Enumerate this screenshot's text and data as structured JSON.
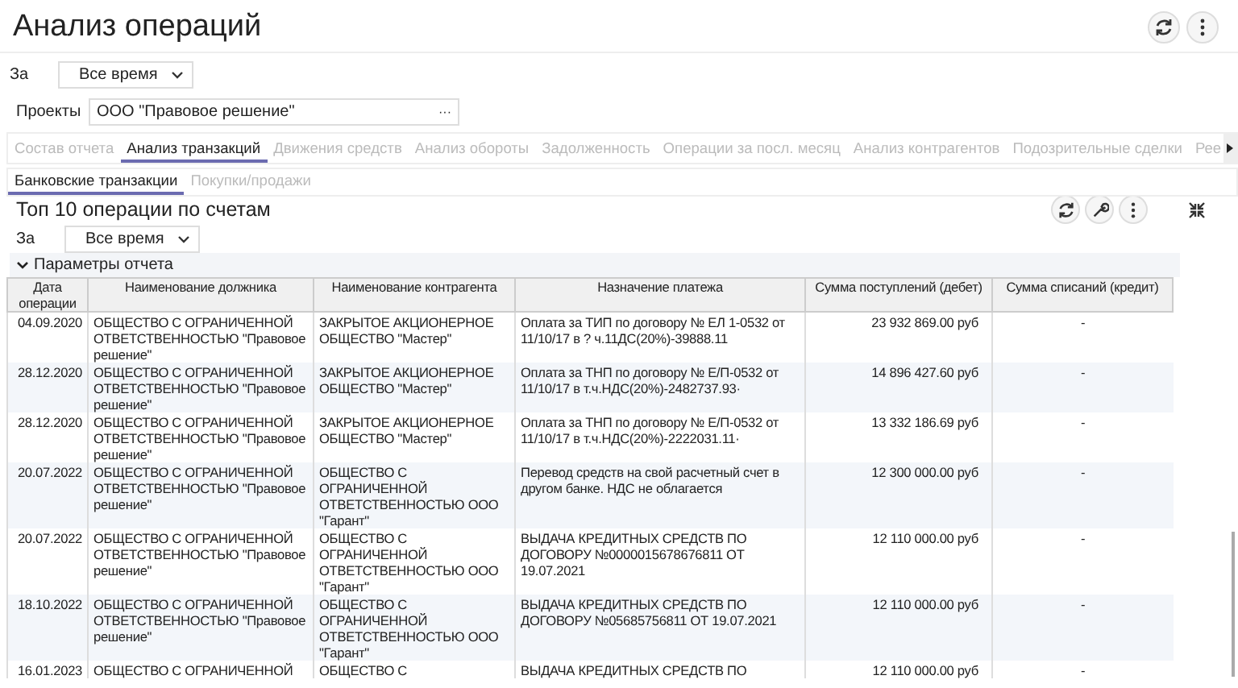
{
  "window": {
    "title": "Анализ операций"
  },
  "period": {
    "label": "За",
    "value": "Все время"
  },
  "projects": {
    "label": "Проекты",
    "value": "ООО \"Правовое решение\"",
    "button": "···"
  },
  "tabs": [
    {
      "label": "Состав отчета",
      "selected": false
    },
    {
      "label": "Анализ транзакций",
      "selected": true
    },
    {
      "label": "Движения средств",
      "selected": false
    },
    {
      "label": "Анализ обороты",
      "selected": false
    },
    {
      "label": "Задолженность",
      "selected": false
    },
    {
      "label": "Операции за посл. месяц",
      "selected": false
    },
    {
      "label": "Анализ контрагентов",
      "selected": false
    },
    {
      "label": "Подозрительные сделки",
      "selected": false
    },
    {
      "label": "Рее",
      "selected": false
    }
  ],
  "subtabs": [
    {
      "label": "Банковские транзакции",
      "selected": true
    },
    {
      "label": "Покупки/продажи",
      "selected": false
    }
  ],
  "report": {
    "title": "Топ 10 операции по счетам",
    "period": {
      "label": "За",
      "value": "Все время"
    },
    "params": {
      "label": "Параметры отчета",
      "expanded": true
    }
  },
  "table": {
    "columns": [
      "Дата операции",
      "Наименование должника",
      "Наименование контрагента",
      "Назначение платежа",
      "Сумма поступлений (дебет)",
      "Сумма списаний (кредит)"
    ],
    "rows": [
      [
        "04.09.2020",
        "ОБЩЕСТВО С ОГРАНИЧЕННОЙ ОТВЕТСТВЕННОСТЬЮ \"Правовое решение\"",
        "ЗАКРЫТОЕ АКЦИОНЕРНОЕ ОБЩЕСТВО \"Мастер\"",
        "Оплата за ТИП по договору № ЕЛ 1-0532 от 11/10/17 в ? ч.11ДС(20%)-39888.11",
        "23 932 869.00  руб",
        "-"
      ],
      [
        "28.12.2020",
        "ОБЩЕСТВО С ОГРАНИЧЕННОЙ ОТВЕТСТВЕННОСТЬЮ \"Правовое решение\"",
        "ЗАКРЫТОЕ АКЦИОНЕРНОЕ ОБЩЕСТВО \"Мастер\"",
        "Оплата за ТНП по договору № Е/П-0532 от 11/10/17 в т.ч.НДС(20%)-2482737.93·",
        "14 896 427.60  руб",
        "-"
      ],
      [
        "28.12.2020",
        "ОБЩЕСТВО С ОГРАНИЧЕННОЙ ОТВЕТСТВЕННОСТЬЮ \"Правовое решение\"",
        "ЗАКРЫТОЕ АКЦИОНЕРНОЕ ОБЩЕСТВО \"Мастер\"",
        "Оплата за ТНП по договору № Е/П-0532 от 11/10/17 в т.ч.НДС(20%)-2222031.11·",
        "13 332 186.69  руб",
        "-"
      ],
      [
        "20.07.2022",
        "ОБЩЕСТВО С ОГРАНИЧЕННОЙ ОТВЕТСТВЕННОСТЬЮ \"Правовое решение\"",
        "ОБЩЕСТВО С ОГРАНИЧЕННОЙ ОТВЕТСТВЕННОСТЬЮ ООО \"Гарант\"",
        "Перевод средств на свой расчетный счет в другом банке. НДС не облагается",
        "12 300 000.00  руб",
        "-"
      ],
      [
        "20.07.2022",
        "ОБЩЕСТВО С ОГРАНИЧЕННОЙ ОТВЕТСТВЕННОСТЬЮ \"Правовое решение\"",
        "ОБЩЕСТВО С ОГРАНИЧЕННОЙ ОТВЕТСТВЕННОСТЬЮ ООО \"Гарант\"",
        "ВЫДАЧА КРЕДИТНЫХ СРЕДСТВ ПО ДОГОВОРУ №0000015678676811 ОТ 19.07.2021",
        "12 110 000.00  руб",
        "-"
      ],
      [
        "18.10.2022",
        "ОБЩЕСТВО С ОГРАНИЧЕННОЙ ОТВЕТСТВЕННОСТЬЮ \"Правовое решение\"",
        "ОБЩЕСТВО С ОГРАНИЧЕННОЙ ОТВЕТСТВЕННОСТЬЮ ООО \"Гарант\"",
        "ВЫДАЧА КРЕДИТНЫХ СРЕДСТВ ПО ДОГОВОРУ №05685756811 ОТ 19.07.2021",
        "12 110 000.00  руб",
        "-"
      ],
      [
        "16.01.2023",
        "ОБЩЕСТВО С ОГРАНИЧЕННОЙ",
        "ОБЩЕСТВО С",
        "ВЫДАЧА КРЕДИТНЫХ СРЕДСТВ ПО",
        "12 110 000.00  руб",
        "-"
      ]
    ]
  }
}
